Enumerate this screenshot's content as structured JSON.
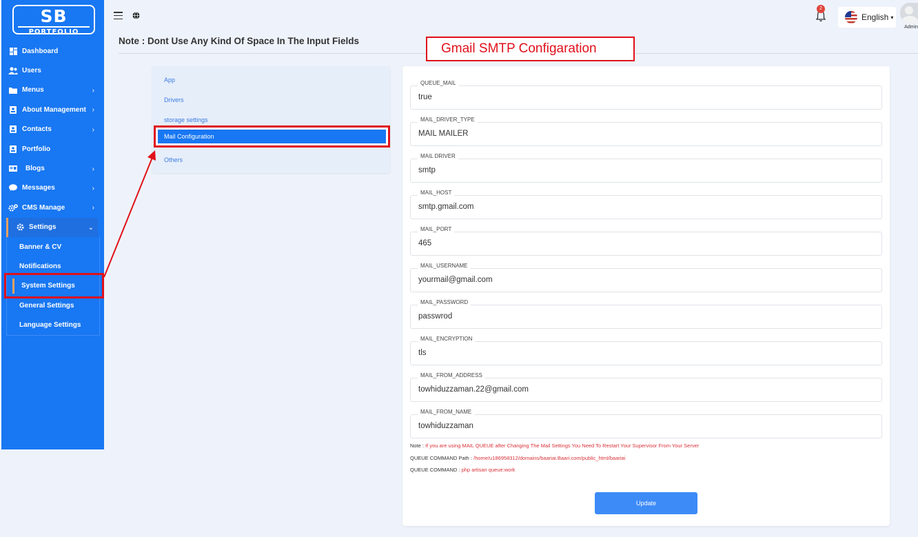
{
  "logo": {
    "line1": "SB",
    "line2": "PORTFOLIO"
  },
  "sidebar": {
    "items": [
      {
        "label": "Dashboard",
        "icon": "grid-icon",
        "chevron": false
      },
      {
        "label": "Users",
        "icon": "users-icon",
        "chevron": false
      },
      {
        "label": "Menus",
        "icon": "menu-folder-icon",
        "chevron": true
      },
      {
        "label": "About Management",
        "icon": "id-card-icon",
        "chevron": true
      },
      {
        "label": "Contacts",
        "icon": "contact-icon",
        "chevron": true
      },
      {
        "label": "Portfolio",
        "icon": "portfolio-icon",
        "chevron": false
      },
      {
        "label": "Blogs",
        "icon": "blog-icon",
        "chevron": true
      },
      {
        "label": "Messages",
        "icon": "chat-icon",
        "chevron": true
      },
      {
        "label": "CMS Manage",
        "icon": "cogs-icon",
        "chevron": true
      }
    ],
    "settings": {
      "label": "Settings",
      "chevron": "⌄"
    },
    "submenu": [
      "Banner & CV",
      "Notifications",
      "System Settings",
      "General Settings",
      "Language Settings"
    ],
    "active_sub": "System Settings"
  },
  "header": {
    "notification_count": "2",
    "language": "English",
    "user_label": "Admin"
  },
  "page": {
    "note": "Note : Dont Use Any Kind Of Space In The Input Fields",
    "callout": "Gmail SMTP Configaration"
  },
  "settings_nav": {
    "items": [
      "App",
      "Drivers",
      "storage settings",
      "Mail Configuration",
      "Others"
    ],
    "active": "Mail Configuration"
  },
  "form": {
    "fields": [
      {
        "label": "QUEUE_MAIL",
        "value": "true"
      },
      {
        "label": "MAIL_DRIVER_TYPE",
        "value": "MAIL MAILER"
      },
      {
        "label": "MAIL DRIVER",
        "value": "smtp"
      },
      {
        "label": "MAIL_HOST",
        "value": "smtp.gmail.com"
      },
      {
        "label": "MAIL_PORT",
        "value": "465"
      },
      {
        "label": "MAIL_USERNAME",
        "value": "yourmail@gmail.com"
      },
      {
        "label": "MAIL_PASSWORD",
        "value": "passwrod"
      },
      {
        "label": "MAIL_ENCRYPTION",
        "value": "tls"
      },
      {
        "label": "MAIL_FROM_ADDRESS",
        "value": "towhiduzzaman.22@gmail.com"
      },
      {
        "label": "MAIL_FROM_NAME",
        "value": "towhiduzzaman"
      }
    ],
    "notes": {
      "note_label": "Note : ",
      "note_text": "If you are using MAIL QUEUE after Changing The Mail Settings You Need To Restart Your Supervisor From Your Server",
      "path_label": "QUEUE COMMAND Path : ",
      "path_text": "/home/u186958312/domains/baariai.Baari.com/public_html/baariai",
      "cmd_label": "QUEUE COMMAND : ",
      "cmd_text": "php artisan queue:work"
    },
    "update_label": "Update"
  },
  "colors": {
    "sidebar": "#1877f2",
    "highlight": "#e0101a",
    "button": "#3d8bf7",
    "accent_bar": "#f0a060"
  }
}
